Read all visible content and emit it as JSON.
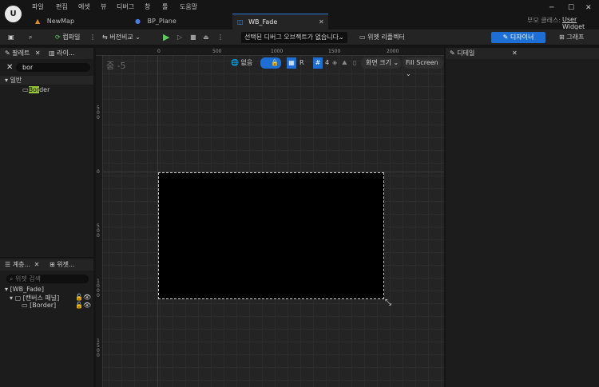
{
  "menu": [
    "파일",
    "편집",
    "에셋",
    "뷰",
    "디버그",
    "창",
    "툴",
    "도움말"
  ],
  "tabs": [
    {
      "label": "NewMap"
    },
    {
      "label": "BP_Plane"
    },
    {
      "label": "WB_Fade"
    }
  ],
  "parent_class": {
    "label": "부모 클래스:",
    "value": "User Widget"
  },
  "toolbar": {
    "compile": "컴파일",
    "diff": "버전비교",
    "debug_select": "선택된 디버그 오브젝트가 없습니다.",
    "widget_reflector": "위젯 리플렉터",
    "designer": "디자이너",
    "graph": "그래프"
  },
  "palette": {
    "tab1": "팔레트",
    "tab2": "라이...",
    "search": "bor",
    "category": "일반",
    "item_prefix": "Bor",
    "item_suffix": "der"
  },
  "hierarchy": {
    "tab1": "계층...",
    "tab2": "위젯...",
    "search_placeholder": "위젯 검색",
    "root": "[WB_Fade]",
    "canvas": "[캔버스 패널]",
    "border": "[Border]"
  },
  "viewport": {
    "zoom": "줌 -5",
    "none": "없음",
    "r": "R",
    "grid_num": "4",
    "screen_size": "화면 크기",
    "fill_screen": "Fill Screen"
  },
  "ruler": {
    "top": [
      "0",
      "500",
      "1000",
      "1500",
      "2000"
    ],
    "left_0": "0",
    "left_500": "500",
    "left_1000": "1000",
    "left_1500": "1500",
    "left_0b": "0"
  },
  "details": {
    "tab": "디테일"
  }
}
